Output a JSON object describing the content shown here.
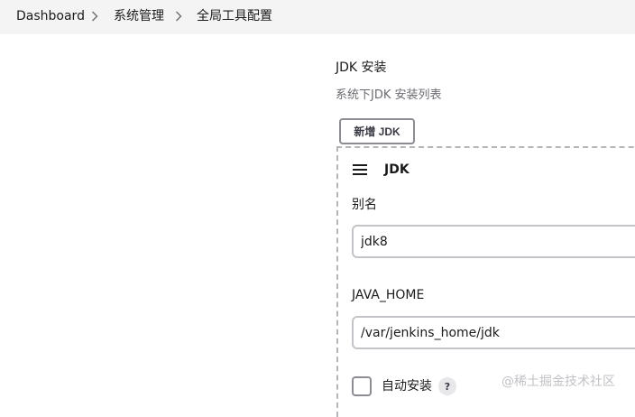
{
  "breadcrumb": {
    "items": [
      {
        "label": "Dashboard"
      },
      {
        "label": "系统管理"
      },
      {
        "label": "全局工具配置"
      }
    ]
  },
  "jdk_section": {
    "title": "JDK 安装",
    "description": "系统下JDK 安装列表",
    "add_button_label": "新增 JDK",
    "panel": {
      "heading": "JDK",
      "alias_label": "别名",
      "alias_value": "jdk8",
      "java_home_label": "JAVA_HOME",
      "java_home_value": "/var/jenkins_home/jdk",
      "auto_install_label": "自动安装",
      "auto_install_checked": false,
      "help_glyph": "?"
    }
  },
  "watermark": "@稀土掘金技术社区",
  "icons": {
    "breadcrumb_separator": "chevron-right-icon",
    "drag_handle": "drag-handle-icon",
    "help": "help-icon"
  }
}
